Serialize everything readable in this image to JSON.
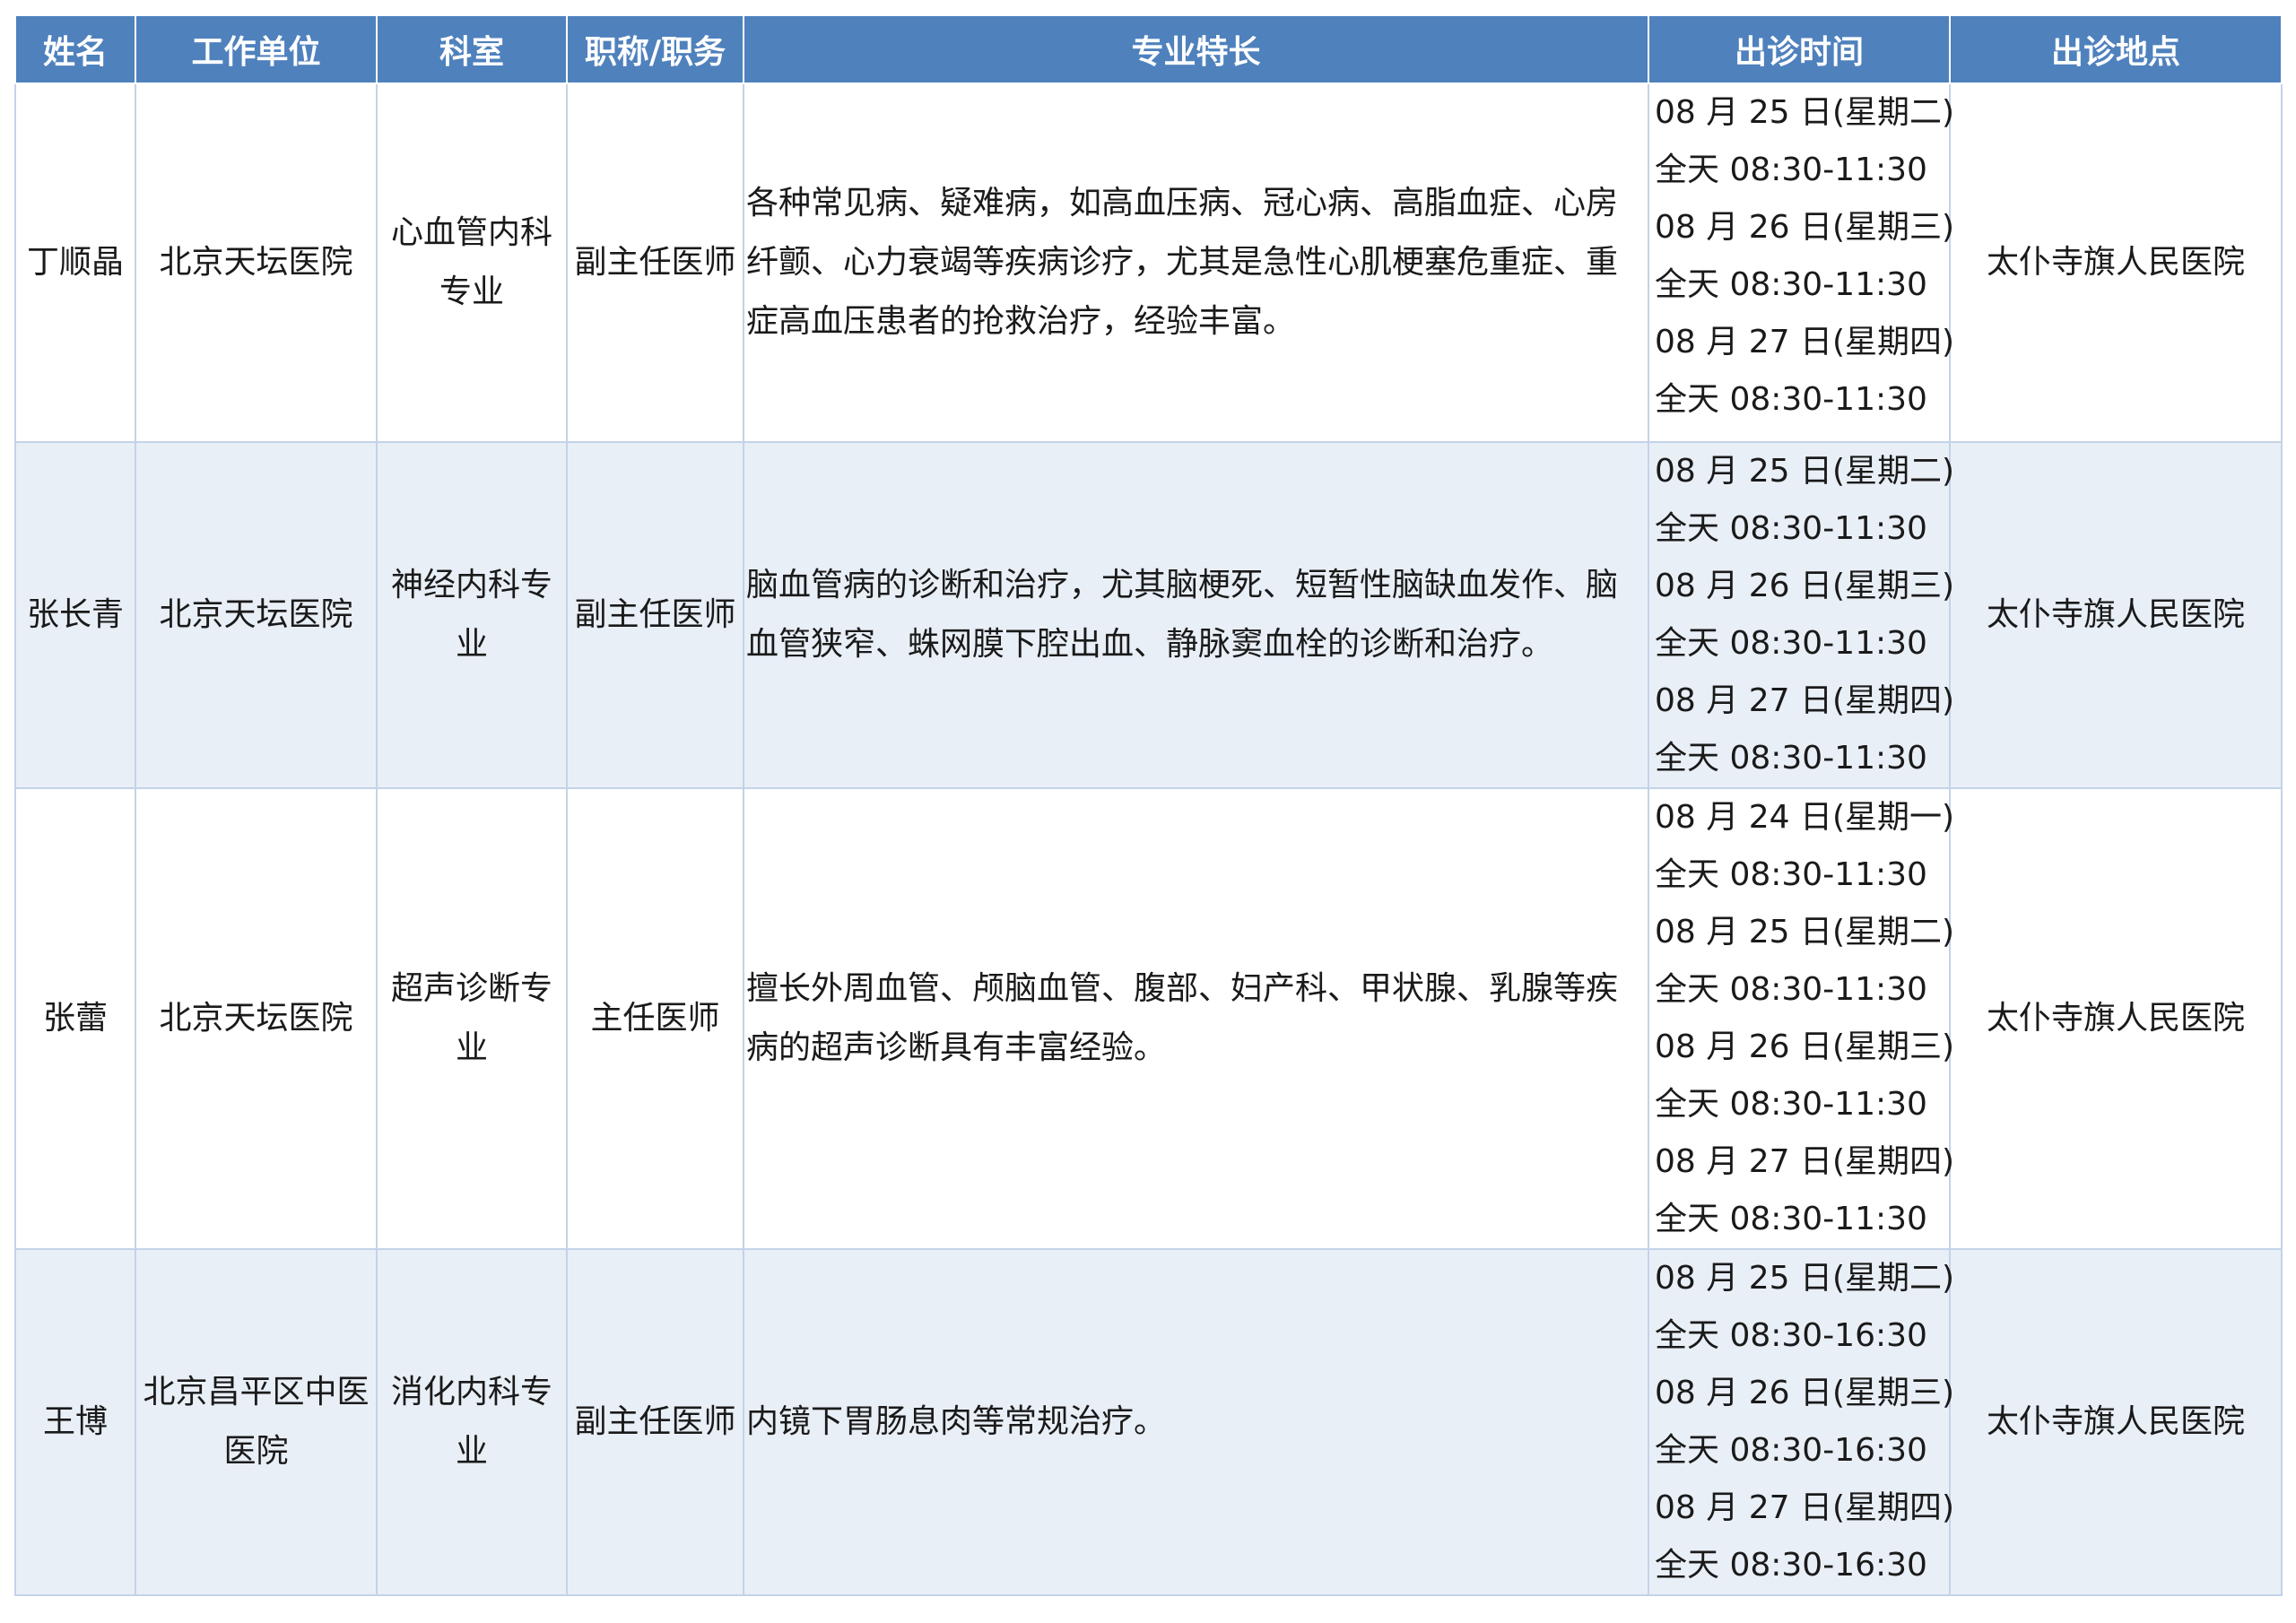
{
  "table": {
    "headers": [
      "姓名",
      "工作单位",
      "科室",
      "职称/职务",
      "专业特长",
      "出诊时间",
      "出诊地点"
    ],
    "rows": [
      {
        "name": "丁顺晶",
        "unit": "北京天坛医院",
        "dept_lines": [
          "心血管内科",
          "专业"
        ],
        "title": "副主任医师",
        "specialty_lines": [
          "各种常见病、疑难病，如高血压病、冠心病、高脂血症、心房",
          "纤颤、心力衰竭等疾病诊疗，尤其是急性心肌梗塞危重症、重",
          "症高血压患者的抢救治疗，经验丰富。"
        ],
        "times": [
          "08 月 25 日(星期二)",
          "全天 08:30-11:30",
          "08 月 26 日(星期三)",
          "全天 08:30-11:30",
          "08 月 27 日(星期四)",
          "全天 08:30-11:30"
        ],
        "location": "太仆寺旗人民医院"
      },
      {
        "name": "张长青",
        "unit": "北京天坛医院",
        "dept_lines": [
          "神经内科专",
          "业"
        ],
        "title": "副主任医师",
        "specialty_lines": [
          "脑血管病的诊断和治疗，尤其脑梗死、短暂性脑缺血发作、脑",
          "血管狭窄、蛛网膜下腔出血、静脉窦血栓的诊断和治疗。"
        ],
        "times": [
          "08 月 25 日(星期二)",
          "全天 08:30-11:30",
          "08 月 26 日(星期三)",
          "全天 08:30-11:30",
          "08 月 27 日(星期四)",
          "全天 08:30-11:30"
        ],
        "location": "太仆寺旗人民医院"
      },
      {
        "name": "张蕾",
        "unit": "北京天坛医院",
        "dept_lines": [
          "超声诊断专",
          "业"
        ],
        "title": "主任医师",
        "specialty_lines": [
          "擅长外周血管、颅脑血管、腹部、妇产科、甲状腺、乳腺等疾",
          "病的超声诊断具有丰富经验。"
        ],
        "times": [
          "08 月 24 日(星期一)",
          "全天 08:30-11:30",
          "08 月 25 日(星期二)",
          "全天 08:30-11:30",
          "08 月 26 日(星期三)",
          "全天 08:30-11:30",
          "08 月 27 日(星期四)",
          "全天 08:30-11:30"
        ],
        "location": "太仆寺旗人民医院"
      },
      {
        "name": "王博",
        "unit_lines": [
          "北京昌平区中医",
          "医院"
        ],
        "dept_lines": [
          "消化内科专",
          "业"
        ],
        "title": "副主任医师",
        "specialty_lines": [
          "内镜下胃肠息肉等常规治疗。"
        ],
        "times": [
          "08 月 25 日(星期二)",
          "全天 08:30-16:30",
          "08 月 26 日(星期三)",
          "全天 08:30-16:30",
          "08 月 27 日(星期四)",
          "全天 08:30-16:30"
        ],
        "location": "太仆寺旗人民医院"
      }
    ]
  },
  "colors": {
    "header_bg": "#4f81bd",
    "header_text": "#ffffff",
    "row_alt_bg": "#e9eff7",
    "border": "#c3d3e8"
  }
}
